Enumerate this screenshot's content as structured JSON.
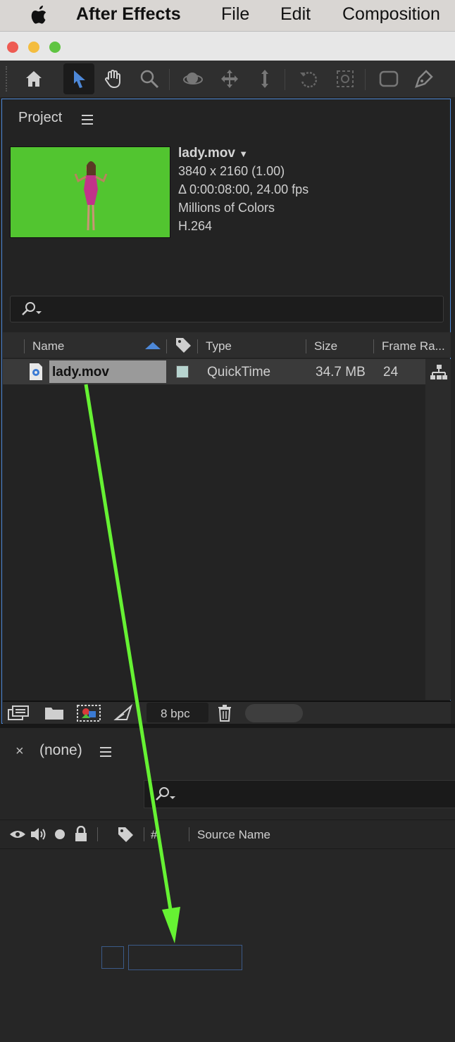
{
  "menubar": {
    "app_name": "After Effects",
    "menus": [
      "File",
      "Edit",
      "Composition"
    ]
  },
  "toolbar": {
    "tools": [
      "home-icon",
      "selection-tool-icon",
      "hand-tool-icon",
      "zoom-tool-icon",
      "orbit-camera-icon",
      "pan-camera-icon",
      "dolly-camera-icon",
      "rotation-tool-icon",
      "pan-behind-icon",
      "rectangle-tool-icon",
      "pen-tool-icon"
    ],
    "accent": "#4d88d8"
  },
  "project_panel": {
    "title": "Project",
    "footage": {
      "name": "lady.mov",
      "dimensions": "3840 x 2160 (1.00)",
      "duration": "Δ 0:00:08:00, 24.00 fps",
      "colors": "Millions of Colors",
      "codec": "H.264"
    },
    "columns": {
      "name": "Name",
      "type": "Type",
      "size": "Size",
      "frame_rate": "Frame Ra..."
    },
    "rows": [
      {
        "name": "lady.mov",
        "type": "QuickTime",
        "size": "34.7 MB",
        "frame_rate": "24",
        "label_color": "#b7d4cf"
      }
    ],
    "bpc": "8 bpc"
  },
  "timeline_panel": {
    "title": "(none)",
    "columns": {
      "number": "#",
      "source_name": "Source Name"
    }
  },
  "annotation": {
    "arrow_color": "#66f233"
  }
}
